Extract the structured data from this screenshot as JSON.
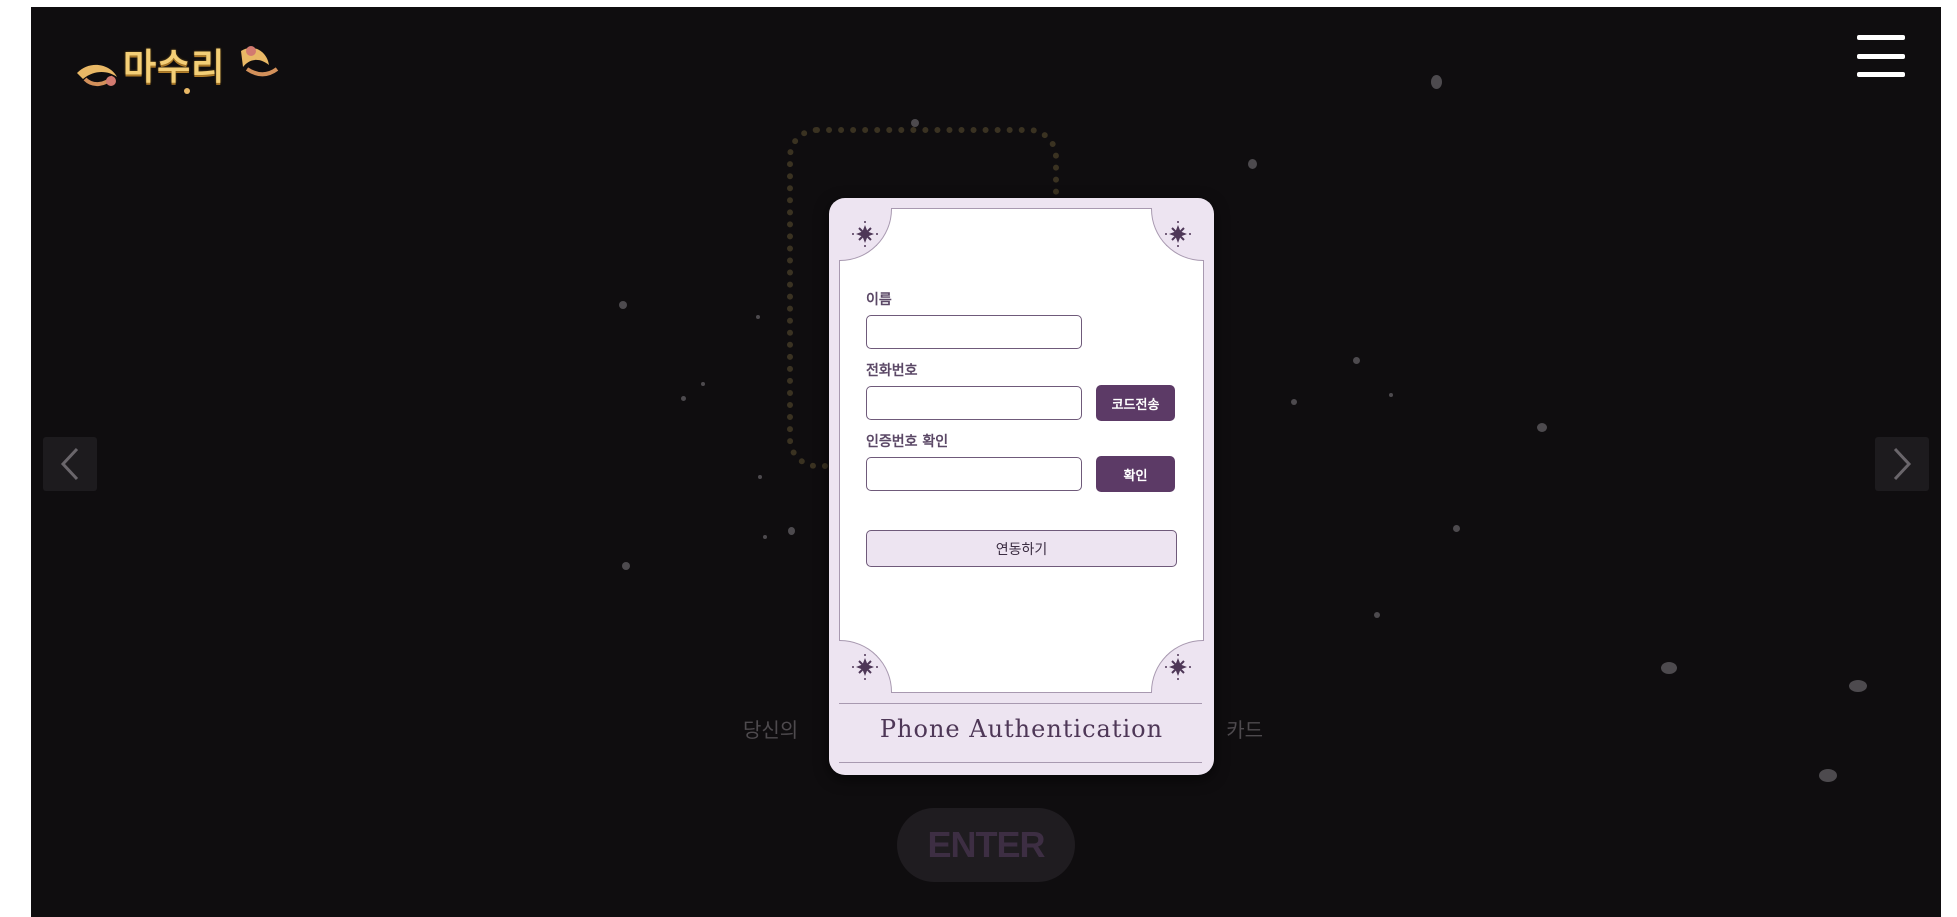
{
  "app": {
    "logo_text": "마수리"
  },
  "header": {
    "menu_icon": "hamburger-menu-icon"
  },
  "carousel": {
    "prev_icon": "chevron-left-icon",
    "next_icon": "chevron-right-icon"
  },
  "background": {
    "tagline_left": "당신의",
    "tagline_right": "카드",
    "enter_label": "ENTER"
  },
  "modal": {
    "title": "Phone Authentication",
    "name_label": "이름",
    "name_value": "",
    "phone_label": "전화번호",
    "phone_value": "",
    "send_code_label": "코드전송",
    "verify_label": "인증번호 확인",
    "verify_value": "",
    "confirm_label": "확인",
    "link_label": "연동하기",
    "corner_icon": "star-burst-icon"
  },
  "colors": {
    "background": "#0f0d0f",
    "modal_bg": "#ede4f1",
    "accent": "#5c3a66",
    "title": "#4e3757"
  }
}
